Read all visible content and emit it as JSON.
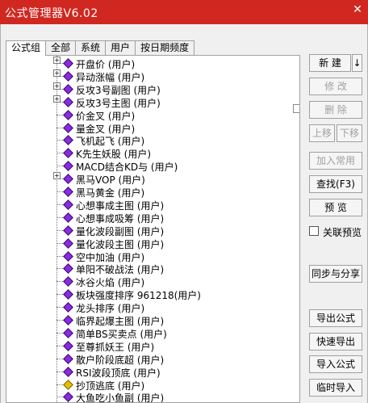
{
  "window": {
    "title": "公式管理器V6.02",
    "close_icon": "✕"
  },
  "tabs": [
    "公式组",
    "全部",
    "系统",
    "用户",
    "按日期频度"
  ],
  "tree": [
    {
      "label": "开盘价  (用户)",
      "expander": "+",
      "icon": "purple"
    },
    {
      "label": "异动涨幅  (用户)",
      "expander": "+",
      "icon": "purple"
    },
    {
      "label": "反攻3号副图  (用户)",
      "expander": "+",
      "icon": "purple"
    },
    {
      "label": "反攻3号主图  (用户)",
      "expander": "+",
      "icon": "purple"
    },
    {
      "label": "价金叉  (用户)",
      "expander": "",
      "icon": "purple"
    },
    {
      "label": "量金叉  (用户)",
      "expander": "",
      "icon": "purple"
    },
    {
      "label": "飞机起飞  (用户)",
      "expander": "",
      "icon": "purple"
    },
    {
      "label": "K先生妖股  (用户)",
      "expander": "",
      "icon": "purple"
    },
    {
      "label": "MACD结合KD与  (用户)",
      "expander": "",
      "icon": "purple"
    },
    {
      "label": "黑马VOP  (用户)",
      "expander": "+",
      "icon": "purple"
    },
    {
      "label": "黑马黄金  (用户)",
      "expander": "",
      "icon": "purple"
    },
    {
      "label": "心想事成主图  (用户)",
      "expander": "",
      "icon": "purple"
    },
    {
      "label": "心想事成吸筹  (用户)",
      "expander": "",
      "icon": "purple"
    },
    {
      "label": "量化波段副图  (用户)",
      "expander": "",
      "icon": "purple"
    },
    {
      "label": "量化波段主图  (用户)",
      "expander": "",
      "icon": "purple"
    },
    {
      "label": "空中加油  (用户)",
      "expander": "",
      "icon": "purple"
    },
    {
      "label": "单阳不破战法  (用户)",
      "expander": "",
      "icon": "purple"
    },
    {
      "label": "冰谷火焰  (用户)",
      "expander": "",
      "icon": "purple"
    },
    {
      "label": "板块强度排序  961218(用户)",
      "expander": "",
      "icon": "purple"
    },
    {
      "label": "龙头排序  (用户)",
      "expander": "",
      "icon": "purple"
    },
    {
      "label": "临界起爆主图  (用户)",
      "expander": "",
      "icon": "purple"
    },
    {
      "label": "简单BS买卖点  (用户)",
      "expander": "",
      "icon": "purple"
    },
    {
      "label": "至尊抓妖王  (用户)",
      "expander": "",
      "icon": "purple"
    },
    {
      "label": "散户阶段底超  (用户)",
      "expander": "",
      "icon": "purple"
    },
    {
      "label": "RSI波段顶底  (用户)",
      "expander": "",
      "icon": "purple"
    },
    {
      "label": "抄顶逃底  (用户)",
      "expander": "",
      "icon": "yellow"
    },
    {
      "label": "大鱼吃小鱼副  (用户)",
      "expander": "",
      "icon": "purple"
    }
  ],
  "buttons": {
    "new": "新  建",
    "new_arrow": "↓",
    "modify": "修  改",
    "delete": "删  除",
    "move_up": "上移",
    "move_down": "下移",
    "add_common": "加入常用",
    "find": "查找(F3)",
    "preview": "预  览",
    "linked_preview": "关联预览",
    "sync_share": "同步与分享",
    "export": "导出公式",
    "quick_export": "快速导出",
    "import": "导入公式",
    "temp_import": "临时导入"
  }
}
